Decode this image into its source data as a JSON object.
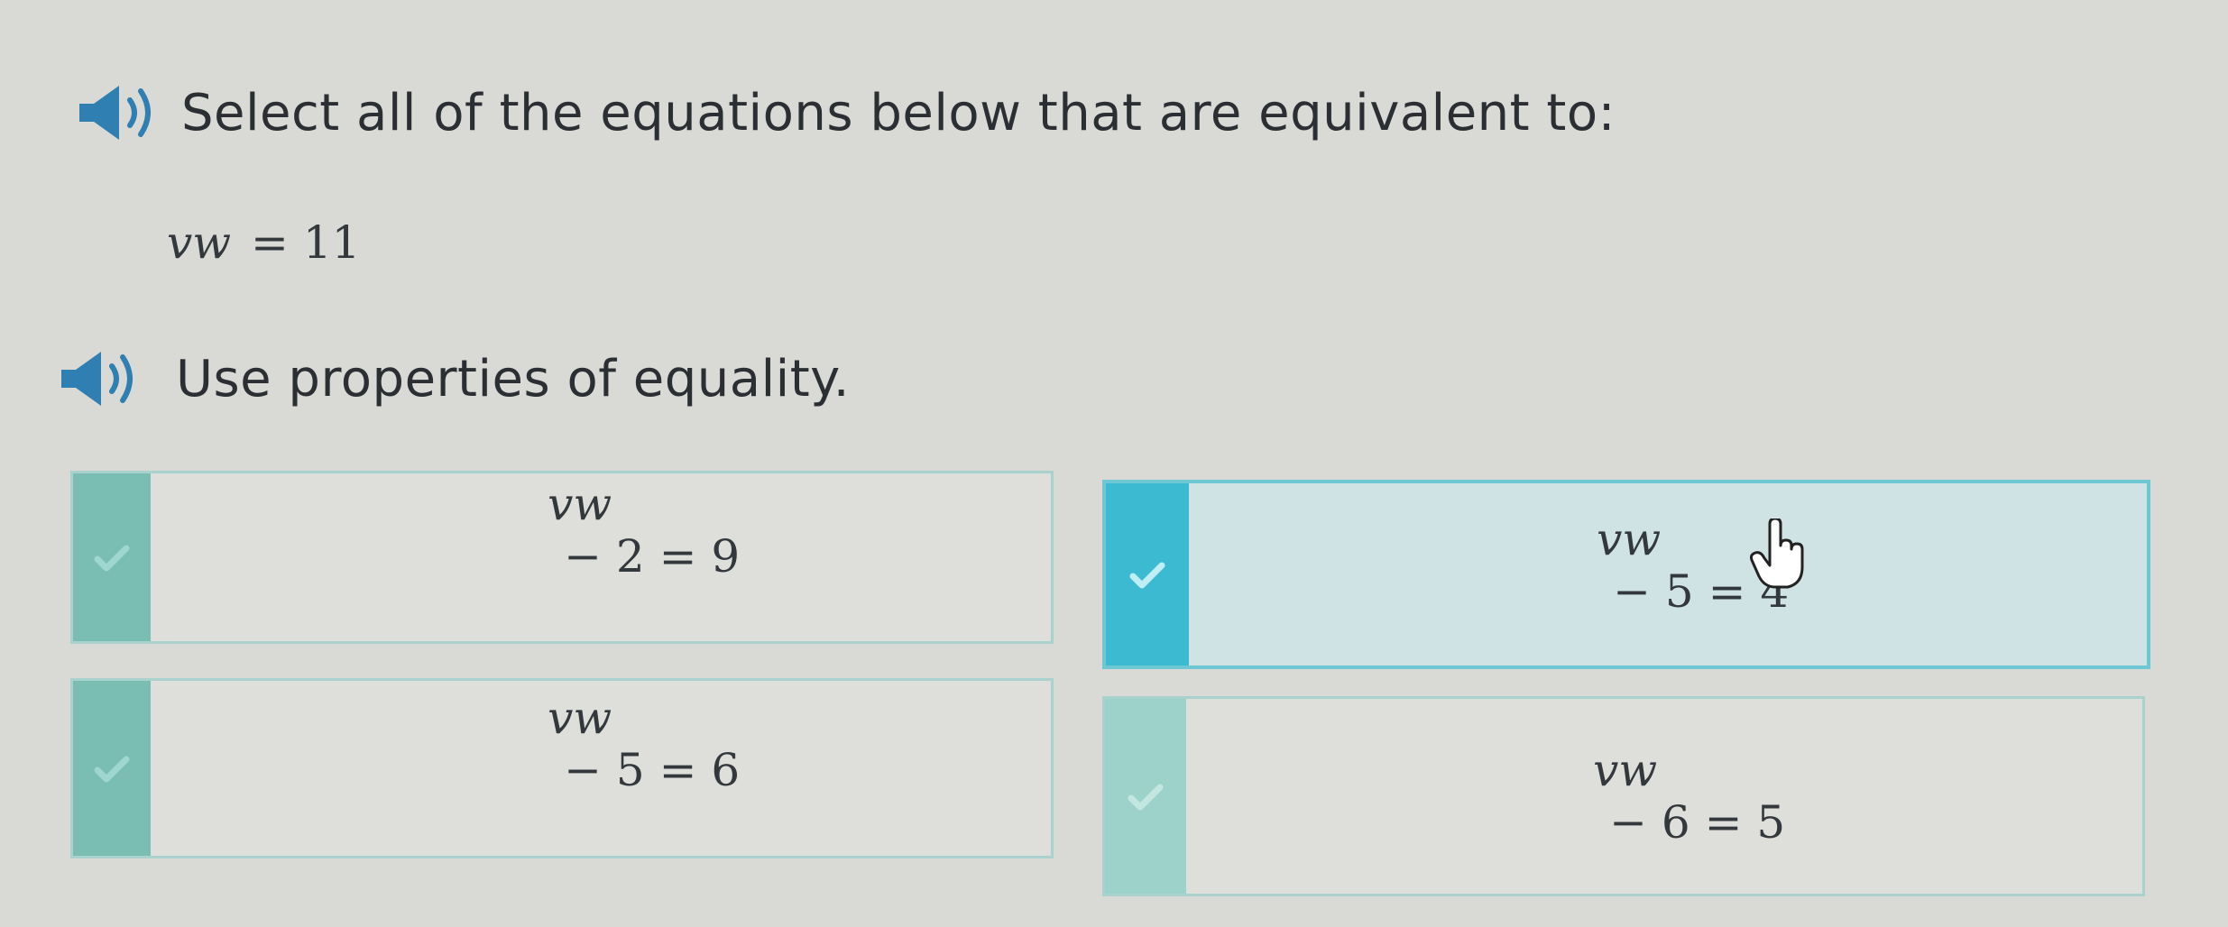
{
  "prompt": {
    "title": "Select all of the equations below that are equivalent to:",
    "target_equation": {
      "lhs": "vw",
      "rhs": "= 11"
    },
    "hint": "Use properties of equality."
  },
  "choices": [
    {
      "lhs": "vw",
      "rhs": "− 2 = 9",
      "selected": false
    },
    {
      "lhs": "vw",
      "rhs": "− 5 = 4",
      "selected": true
    },
    {
      "lhs": "vw",
      "rhs": "− 5 = 6",
      "selected": false
    },
    {
      "lhs": "vw",
      "rhs": "− 6 = 5",
      "selected": false
    }
  ],
  "icons": {
    "speaker": "speaker-icon",
    "check": "checkmark-icon",
    "cursor": "hand-pointer-icon"
  },
  "colors": {
    "background": "#d9dad6",
    "choice_border": "#a9d2cf",
    "choice_tab": "#79bdb3",
    "selected_tab": "#3cbad2",
    "selected_border": "#6ec8d4",
    "text": "#2b2f33"
  }
}
